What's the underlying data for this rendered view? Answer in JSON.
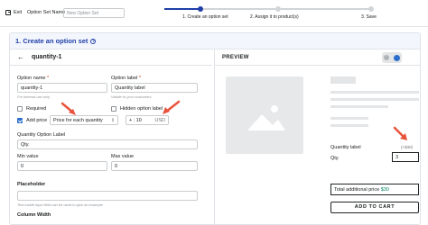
{
  "topbar": {
    "exit_label": "Exit",
    "set_name_label": "Option Set Name",
    "set_name_placeholder": "New Option Set"
  },
  "steps": [
    {
      "label": "1. Create an option set",
      "state": "active"
    },
    {
      "label": "2. Assign it to product(s)",
      "state": "pending"
    },
    {
      "label": "3. Save",
      "state": "pending"
    }
  ],
  "panel": {
    "title": "1. Create an option set"
  },
  "editor": {
    "option_title": "quantity-1",
    "option_name_label": "Option name",
    "option_name_value": "quantity-1",
    "option_name_hint": "For internal use only",
    "option_label_label": "Option label",
    "option_label_value": "Quantity label",
    "option_label_hint": "Visible to your customers",
    "required_label": "Required",
    "hidden_label": "Hidden option label",
    "add_price_label": "Add price",
    "price_type_value": "Price for each quantity",
    "price_sign": "+",
    "price_amount": "10",
    "price_currency": "USD",
    "qty_option_label_label": "Quantity Option Label",
    "qty_option_label_value": "Qty.",
    "min_value_label": "Min value",
    "min_value_value": "0",
    "max_value_label": "Max value",
    "max_value_value": "0",
    "placeholder_label": "Placeholder",
    "placeholder_hint": "Text inside input field can be used to give an example",
    "column_width_label": "Column Width"
  },
  "preview": {
    "title": "PREVIEW",
    "quantity_label": "Quantity label",
    "price_tag": "(+$30)",
    "qty_label": "Qty.",
    "qty_value": "3",
    "total_label": "Total additional price",
    "total_value": "$30",
    "add_to_cart": "ADD TO CART"
  },
  "colors": {
    "accent": "#2c6ecb",
    "step_active": "#1f3fa8",
    "arrow": "#e8533c"
  }
}
